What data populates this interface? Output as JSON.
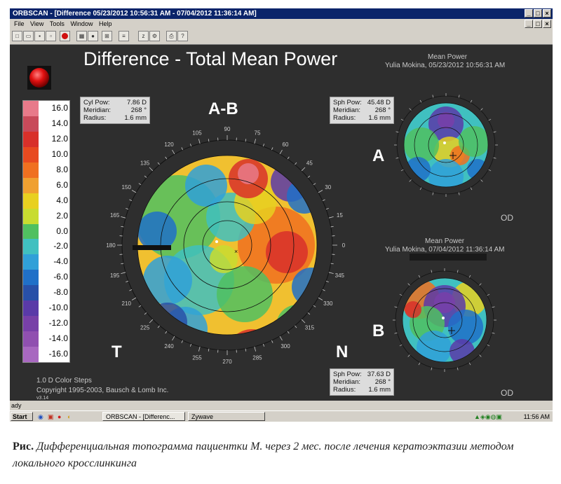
{
  "window": {
    "title": "ORBSCAN - [Difference 05/23/2012 10:56:31 AM - 07/04/2012 11:36:14 AM]",
    "buttons": [
      "_",
      "□",
      "×"
    ]
  },
  "menu": [
    "File",
    "View",
    "Tools",
    "Window",
    "Help"
  ],
  "mdi_buttons": [
    "_",
    "□",
    "×"
  ],
  "main": {
    "title": "Difference - Total Mean Power",
    "map_label": "A-B",
    "side_t": "T",
    "side_n": "N",
    "footer_steps": "1.0 D Color Steps",
    "footer_copy": "Copyright 1995-2003, Bausch & Lomb Inc.",
    "version": "v3.14"
  },
  "main_info": {
    "cyl_label": "Cyl Pow:",
    "cyl_value": "7.86 D",
    "meridian_label": "Meridian:",
    "meridian_value": "268 °",
    "radius_label": "Radius:",
    "radius_value": "1.6 mm"
  },
  "scale": {
    "labels": [
      "16.0",
      "14.0",
      "12.0",
      "10.0",
      "8.0",
      "6.0",
      "4.0",
      "2.0",
      "0.0",
      "-2.0",
      "-4.0",
      "-6.0",
      "-8.0",
      "-10.0",
      "-12.0",
      "-14.0",
      "-16.0"
    ],
    "colors": [
      "#e87a8a",
      "#c84a5a",
      "#d8302a",
      "#e84a20",
      "#f07020",
      "#f0a030",
      "#e8d020",
      "#c8dc30",
      "#50c060",
      "#40c0c0",
      "#30a0d8",
      "#2070c8",
      "#2850a8",
      "#5a3aa8",
      "#7840a8",
      "#9050b0",
      "#a868c0"
    ]
  },
  "angles": [
    "90",
    "75",
    "60",
    "45",
    "30",
    "15",
    "0",
    "345",
    "330",
    "315",
    "300",
    "285",
    "270",
    "255",
    "240",
    "225",
    "210",
    "195",
    "180",
    "165",
    "150",
    "135",
    "120",
    "105"
  ],
  "map_a": {
    "header1": "Mean Power",
    "header2": "Yulia Mokina, 05/23/2012 10:56:31 AM",
    "letter": "A",
    "eye": "OD",
    "sph_label": "Sph Pow:",
    "sph_value": "45.48 D",
    "meridian_label": "Meridian:",
    "meridian_value": "268 °",
    "radius_label": "Radius:",
    "radius_value": "1.6 mm"
  },
  "map_b": {
    "header1": "Mean Power",
    "header2": "Yulia Mokina, 07/04/2012 11:36:14 AM",
    "letter": "B",
    "eye": "OD",
    "sph_label": "Sph Pow:",
    "sph_value": "37.63 D",
    "meridian_label": "Meridian:",
    "meridian_value": "268 °",
    "radius_label": "Radius:",
    "radius_value": "1.6 mm"
  },
  "status": "ady",
  "taskbar": {
    "start": "Start",
    "task1": "ORBSCAN - [Differenc...",
    "task2": "Zywave",
    "clock": "11:56 AM"
  },
  "caption": {
    "lead": "Рис.",
    "text": "Дифференциальная топограмма пациентки М. через 2 мес. после лечения кератоэктазии методом локального кросслинкинга"
  }
}
